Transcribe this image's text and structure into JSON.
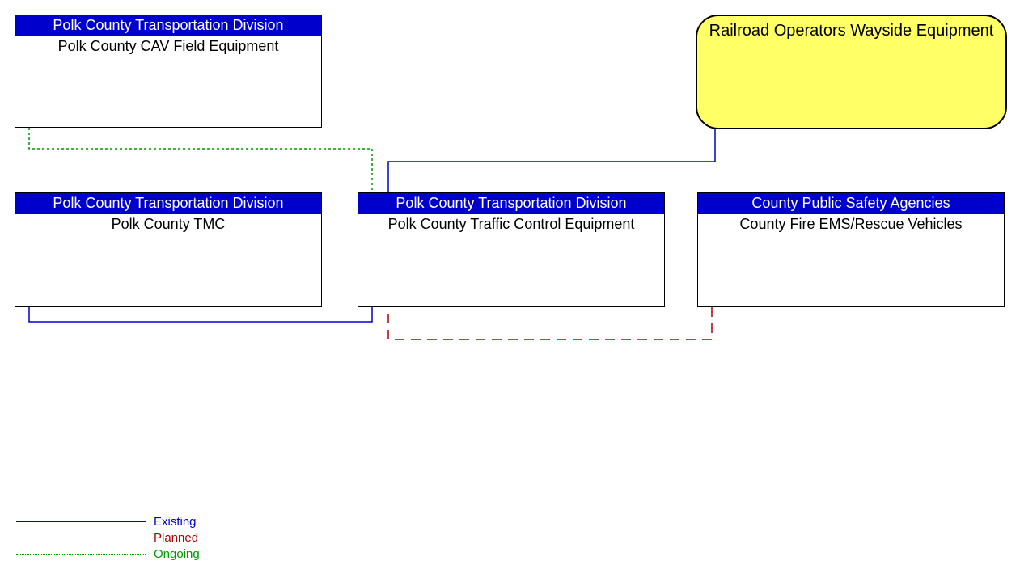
{
  "nodes": {
    "cav": {
      "header": "Polk County Transportation Division",
      "body": "Polk County CAV Field Equipment"
    },
    "railroad": {
      "body": "Railroad Operators Wayside Equipment"
    },
    "tmc": {
      "header": "Polk County Transportation Division",
      "body": "Polk County TMC"
    },
    "traffic": {
      "header": "Polk County Transportation Division",
      "body": "Polk County Traffic Control Equipment"
    },
    "fire": {
      "header": "County Public Safety Agencies",
      "body": "County Fire EMS/Rescue Vehicles"
    }
  },
  "legend": {
    "existing": "Existing",
    "planned": "Planned",
    "ongoing": "Ongoing"
  },
  "connections": [
    {
      "from": "cav",
      "to": "traffic",
      "status": "ongoing"
    },
    {
      "from": "railroad",
      "to": "traffic",
      "status": "existing"
    },
    {
      "from": "tmc",
      "to": "traffic",
      "status": "existing"
    },
    {
      "from": "fire",
      "to": "traffic",
      "status": "planned"
    }
  ],
  "colors": {
    "existing": "#0000cc",
    "planned": "#aa0000",
    "ongoing": "#009900",
    "headerBg": "#0000cc",
    "roundedBg": "#ffff66"
  }
}
